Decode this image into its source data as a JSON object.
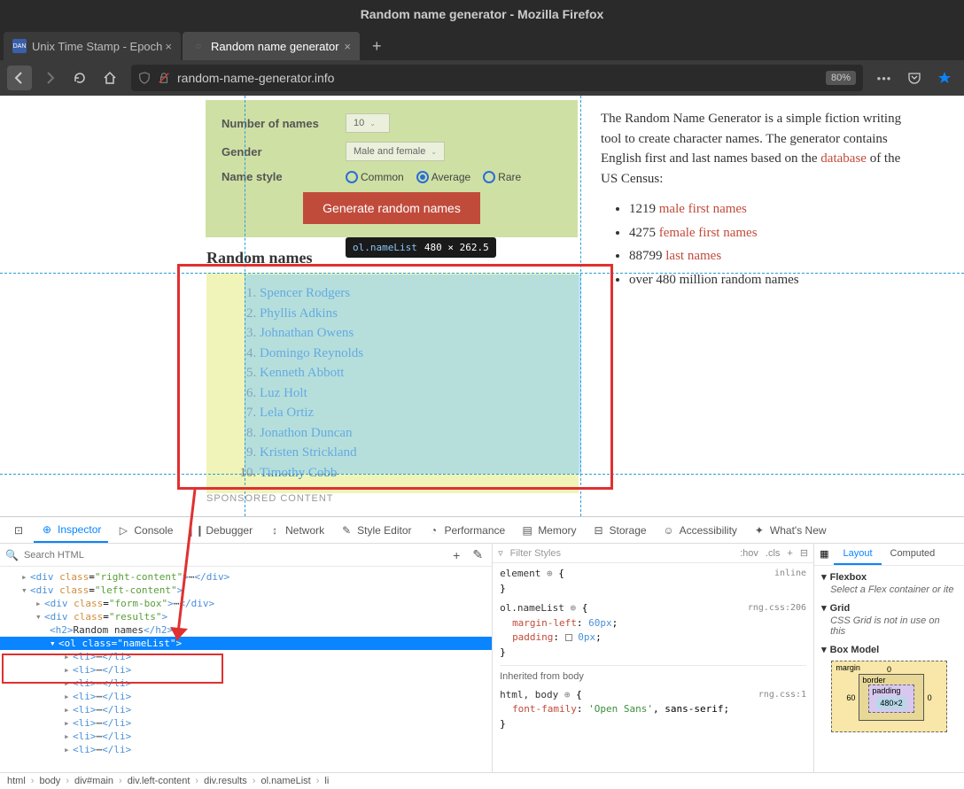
{
  "window": {
    "title": "Random name generator - Mozilla Firefox"
  },
  "tabs": {
    "inactive": "Unix Time Stamp - Epoch",
    "active": "Random name generator"
  },
  "url": {
    "text": "random-name-generator.info",
    "zoom": "80%"
  },
  "form": {
    "number_label": "Number of names",
    "number_value": "10",
    "gender_label": "Gender",
    "gender_value": "Male and female",
    "style_label": "Name style",
    "style_common": "Common",
    "style_average": "Average",
    "style_rare": "Rare",
    "button": "Generate random names"
  },
  "right": {
    "intro_a": "The Random Name Generator is a simple fiction writing tool to create character names. The generator contains English first and last names based on the ",
    "intro_link": "database",
    "intro_b": " of the US Census:",
    "li1_n": "1219 ",
    "li1_a": "male first names",
    "li2_n": "4275 ",
    "li2_a": "female first names",
    "li3_n": "88799 ",
    "li3_a": "last names",
    "li4": "over 480 million random names"
  },
  "results": {
    "heading": "Random names",
    "names": [
      "Spencer Rodgers",
      "Phyllis Adkins",
      "Johnathan Owens",
      "Domingo Reynolds",
      "Kenneth Abbott",
      "Luz Holt",
      "Lela Ortiz",
      "Jonathon Duncan",
      "Kristen Strickland",
      "Timothy Cobb"
    ]
  },
  "tooltip": {
    "selector": "ol.nameList",
    "dims": "480 × 262.5"
  },
  "sponsored": "SPONSORED CONTENT",
  "devtools": {
    "tabs": [
      "Inspector",
      "Console",
      "Debugger",
      "Network",
      "Style Editor",
      "Performance",
      "Memory",
      "Storage",
      "Accessibility",
      "What's New"
    ],
    "search_placeholder": "Search HTML",
    "tree": {
      "l1": "div",
      "l1_class": "right-content",
      "l2": "div",
      "l2_class": "left-content",
      "l3": "div",
      "l3_class": "form-box",
      "l4": "div",
      "l4_class": "results",
      "l5_text": "Random names",
      "l6": "ol",
      "l6_class": "nameList",
      "li_close": "li"
    },
    "styles": {
      "filter_placeholder": "Filter Styles",
      "hov": ":hov",
      "cls": ".cls",
      "element": "element",
      "inline": "inline",
      "sel1": "ol.nameList",
      "src1": "rng.css:206",
      "p1": "margin-left",
      "v1": "60px",
      "p2": "padding",
      "v2": "0px",
      "inh": "Inherited from body",
      "sel2": "html, body",
      "src2": "rng.css:1",
      "p3": "font-family",
      "v3a": "'Open Sans'",
      "v3b": ", sans-serif"
    },
    "layout": {
      "tabs": [
        "Layout",
        "Computed"
      ],
      "flexbox": "Flexbox",
      "flexbox_msg": "Select a Flex container or ite",
      "grid": "Grid",
      "grid_msg": "CSS Grid is not in use on this",
      "boxmodel": "Box Model",
      "margin": "margin",
      "border": "border",
      "padding": "padding",
      "bm_left": "60",
      "bm_top": "0",
      "bm_dims": "480×2"
    },
    "crumbs": [
      "html",
      "body",
      "div#main",
      "div.left-content",
      "div.results",
      "ol.nameList",
      "li"
    ]
  }
}
